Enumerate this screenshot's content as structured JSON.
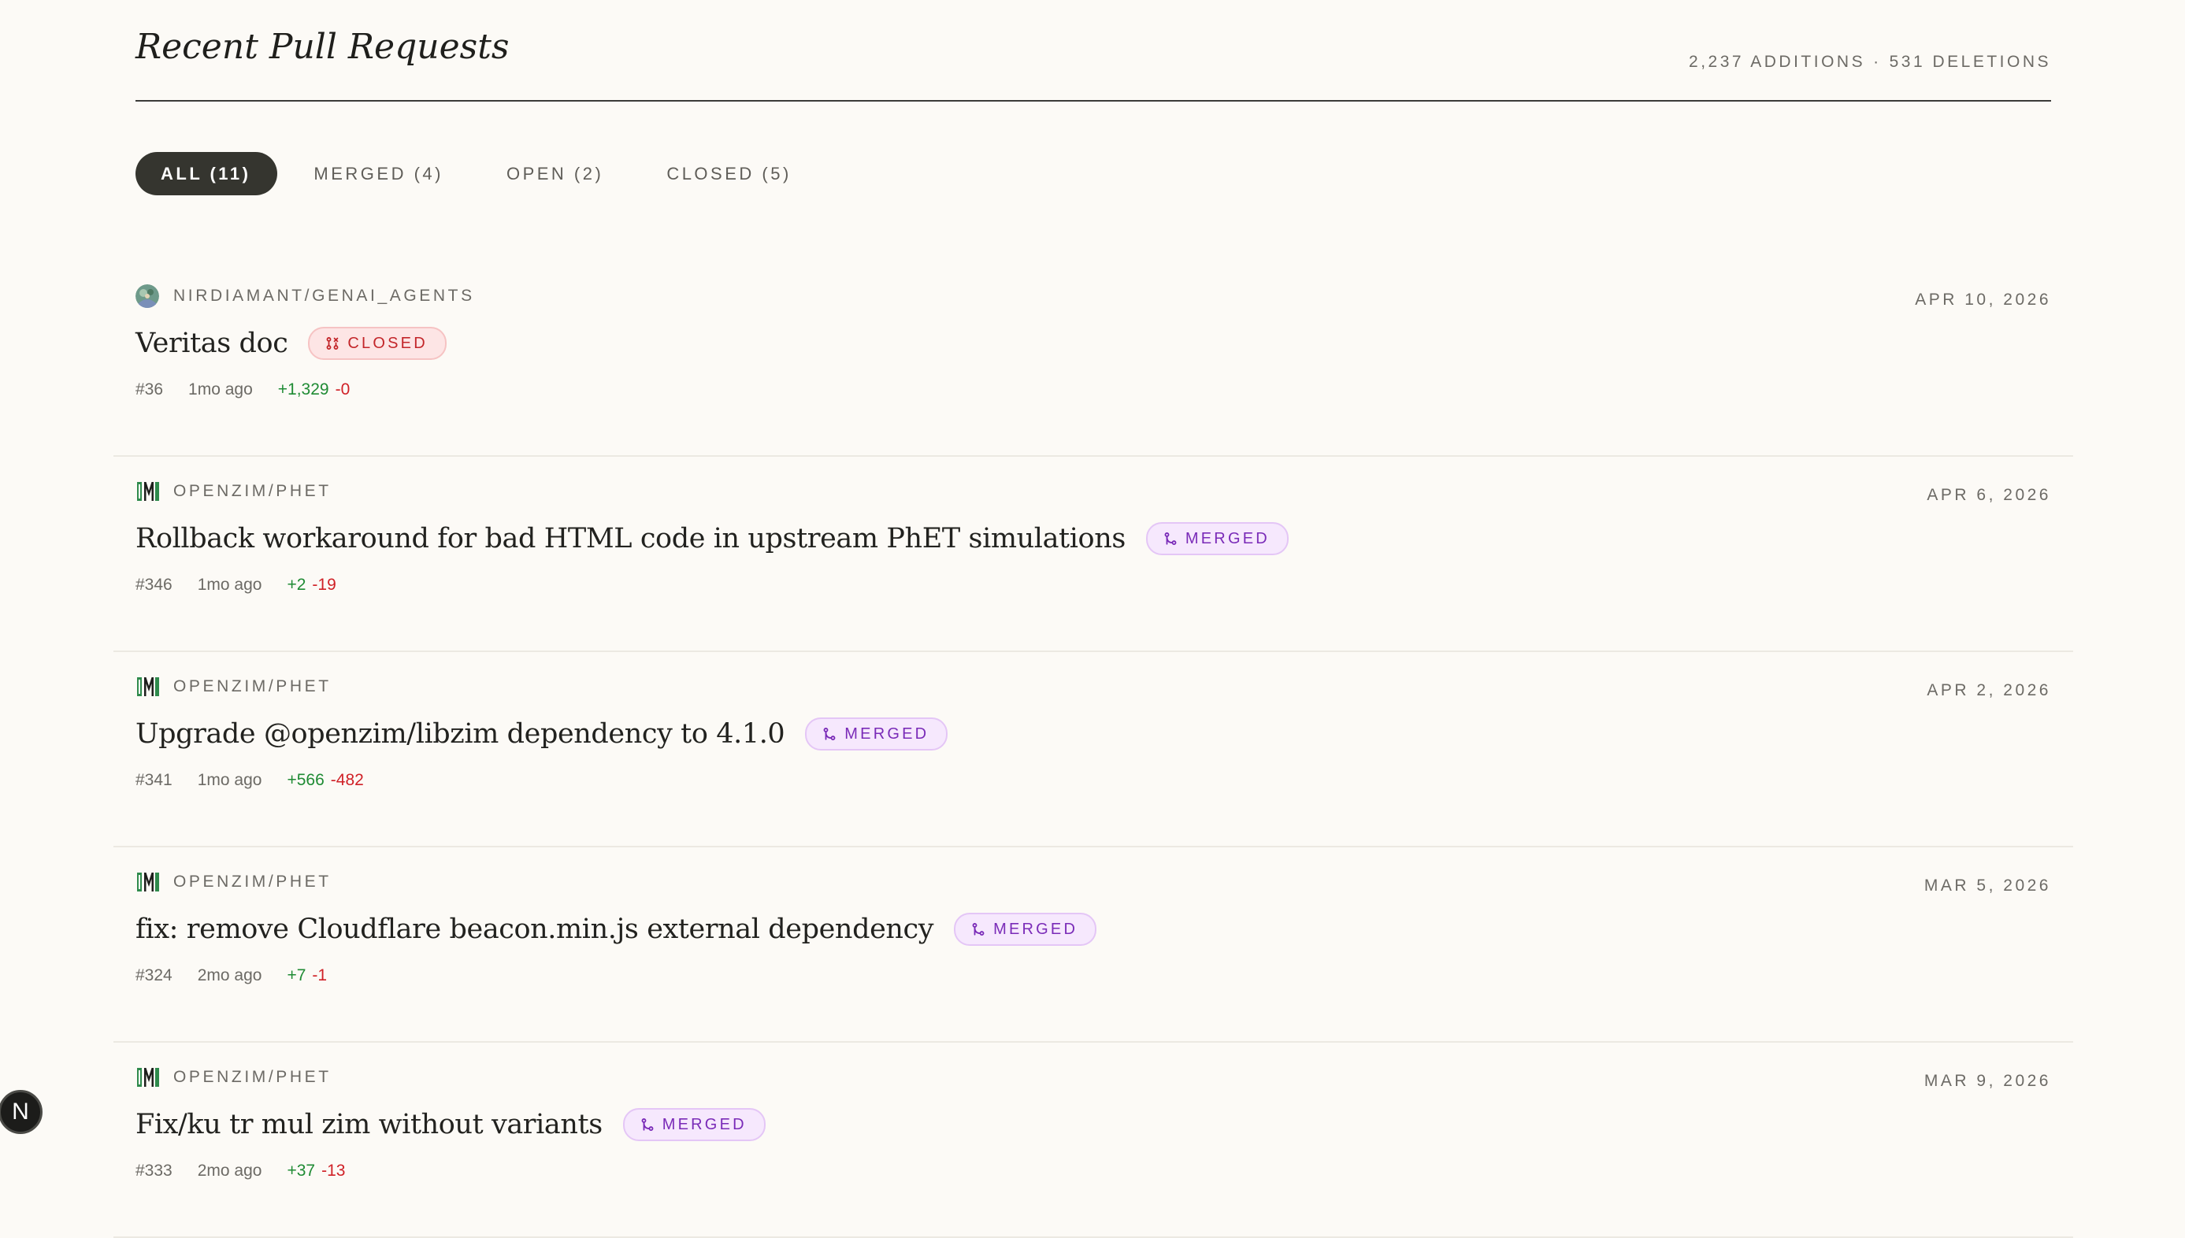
{
  "header": {
    "title": "Recent Pull Requests",
    "additions": "2,237 ADDITIONS",
    "separator": "·",
    "deletions": "531 DELETIONS"
  },
  "tabs": [
    {
      "label": "ALL (11)",
      "active": true
    },
    {
      "label": "MERGED (4)",
      "active": false
    },
    {
      "label": "OPEN (2)",
      "active": false
    },
    {
      "label": "CLOSED (5)",
      "active": false
    }
  ],
  "pull_requests": [
    {
      "repo": "NIRDIAMANT/GENAI_AGENTS",
      "repo_icon": "avatar-icon",
      "title": "Veritas doc",
      "status": "CLOSED",
      "status_icon": "pull-request-closed-icon",
      "number": "#36",
      "ago": "1mo ago",
      "additions": "+1,329",
      "deletions": "-0",
      "date": "APR 10, 2026"
    },
    {
      "repo": "OPENZIM/PHET",
      "repo_icon": "openzim-logo-icon",
      "title": "Rollback workaround for bad HTML code in upstream PhET simulations",
      "status": "MERGED",
      "status_icon": "merge-icon",
      "number": "#346",
      "ago": "1mo ago",
      "additions": "+2",
      "deletions": "-19",
      "date": "APR 6, 2026"
    },
    {
      "repo": "OPENZIM/PHET",
      "repo_icon": "openzim-logo-icon",
      "title": "Upgrade @openzim/libzim dependency to 4.1.0",
      "status": "MERGED",
      "status_icon": "merge-icon",
      "number": "#341",
      "ago": "1mo ago",
      "additions": "+566",
      "deletions": "-482",
      "date": "APR 2, 2026"
    },
    {
      "repo": "OPENZIM/PHET",
      "repo_icon": "openzim-logo-icon",
      "title": "fix: remove Cloudflare beacon.min.js external dependency",
      "status": "MERGED",
      "status_icon": "merge-icon",
      "number": "#324",
      "ago": "2mo ago",
      "additions": "+7",
      "deletions": "-1",
      "date": "MAR 5, 2026"
    },
    {
      "repo": "OPENZIM/PHET",
      "repo_icon": "openzim-logo-icon",
      "title": "Fix/ku tr mul zim without variants",
      "status": "MERGED",
      "status_icon": "merge-icon",
      "number": "#333",
      "ago": "2mo ago",
      "additions": "+37",
      "deletions": "-13",
      "date": "MAR 9, 2026"
    }
  ],
  "dev_indicator": {
    "label": "N"
  },
  "colors": {
    "background": "#fcfaf6",
    "active_tab": "#35352f",
    "closed": "#c3262a",
    "merged": "#7a2bb8",
    "additions": "#1f8b34",
    "deletions": "#d02127"
  }
}
